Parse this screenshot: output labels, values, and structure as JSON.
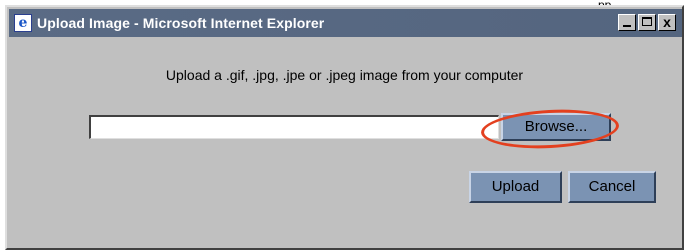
{
  "top_fragment": "pp",
  "window": {
    "title": "Upload Image - Microsoft Internet Explorer",
    "controls": {
      "minimize": "_",
      "maximize": "□",
      "close": "x"
    }
  },
  "dialog": {
    "instruction": "Upload a .gif, .jpg, .jpe or .jpeg image from your computer",
    "file_input_value": "",
    "browse_label": "Browse...",
    "upload_label": "Upload",
    "cancel_label": "Cancel"
  },
  "colors": {
    "titlebar": "#5a6b85",
    "button": "#7b93b3",
    "highlight": "#e3401f"
  },
  "icons": [
    "ie-icon",
    "minimize-icon",
    "maximize-icon",
    "close-icon"
  ]
}
